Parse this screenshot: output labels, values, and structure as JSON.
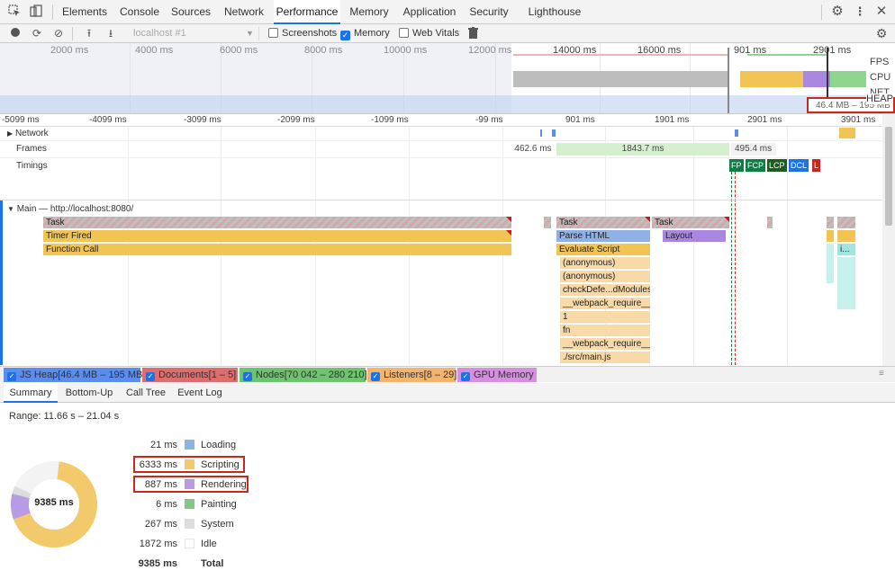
{
  "tabs": [
    {
      "label": "Elements"
    },
    {
      "label": "Console"
    },
    {
      "label": "Sources"
    },
    {
      "label": "Network"
    },
    {
      "label": "Performance",
      "active": true
    },
    {
      "label": "Memory"
    },
    {
      "label": "Application"
    },
    {
      "label": "Security"
    },
    {
      "label": "Lighthouse"
    }
  ],
  "toolbar": {
    "profile_select": "localhost #1",
    "screenshots_label": "Screenshots",
    "screenshots_checked": false,
    "memory_label": "Memory",
    "memory_checked": true,
    "webvitals_label": "Web Vitals",
    "webvitals_checked": false
  },
  "overview": {
    "ticks": [
      "2000 ms",
      "4000 ms",
      "6000 ms",
      "8000 ms",
      "10000 ms",
      "12000 ms",
      "14000 ms",
      "16000 ms",
      "901 ms",
      "2901 ms"
    ],
    "lanes": [
      "FPS",
      "CPU",
      "NET",
      "HEAP"
    ],
    "heap_range": "46.4 MB – 195 MB"
  },
  "timeline": {
    "ruler": [
      "-5099 ms",
      "-4099 ms",
      "-3099 ms",
      "-2099 ms",
      "-1099 ms",
      "-99 ms",
      "901 ms",
      "1901 ms",
      "2901 ms",
      "3901 ms"
    ],
    "network_label": "Network",
    "frames_label": "Frames",
    "frames": [
      "462.6 ms",
      "1843.7 ms",
      "495.4 ms"
    ],
    "timings_label": "Timings",
    "timing_markers": [
      "FP",
      "FCP",
      "LCP",
      "DCL",
      "L"
    ],
    "main_label": "Main — http://localhost:8080/",
    "events": {
      "task1": "Task",
      "timer": "Timer Fired",
      "func": "Function Call",
      "task2": "Task",
      "task3": "Task",
      "parse": "Parse HTML",
      "layout": "Layout",
      "evaluate": "Evaluate Script",
      "anon1": "(anonymous)",
      "anon2": "(anonymous)",
      "check": "checkDefe...dModules",
      "req1": "__webpack_require__",
      "one": "1",
      "fn": "fn",
      "req2": "__webpack_require__",
      "main": "./src/main.js",
      "small": "i..."
    }
  },
  "counters": [
    {
      "label": "JS Heap[46.4 MB – 195 MB]",
      "color": "#5b8def"
    },
    {
      "label": "Documents[1 – 5]",
      "color": "#e06d6d"
    },
    {
      "label": "Nodes[70 042 – 280 210]",
      "color": "#6fc26f"
    },
    {
      "label": "Listeners[8 – 29]",
      "color": "#f3b46e"
    },
    {
      "label": "GPU Memory",
      "color": "#d68fe0"
    }
  ],
  "bottom_tabs": [
    {
      "label": "Summary",
      "active": true
    },
    {
      "label": "Bottom-Up"
    },
    {
      "label": "Call Tree"
    },
    {
      "label": "Event Log"
    }
  ],
  "summary": {
    "range": "Range: 11.66 s – 21.04 s",
    "total_center": "9385 ms",
    "rows": [
      {
        "value": "21 ms",
        "label": "Loading",
        "color": "#8cb3e6",
        "ms": 21
      },
      {
        "value": "6333 ms",
        "label": "Scripting",
        "color": "#f2c96b",
        "ms": 6333
      },
      {
        "value": "887 ms",
        "label": "Rendering",
        "color": "#b99be5",
        "ms": 887
      },
      {
        "value": "6 ms",
        "label": "Painting",
        "color": "#85c785",
        "ms": 6
      },
      {
        "value": "267 ms",
        "label": "System",
        "color": "#dddddd",
        "ms": 267
      },
      {
        "value": "1872 ms",
        "label": "Idle",
        "color": "#ffffff",
        "ms": 1872
      },
      {
        "value": "9385 ms",
        "label": "Total",
        "color": "",
        "ms": 9385
      }
    ]
  }
}
